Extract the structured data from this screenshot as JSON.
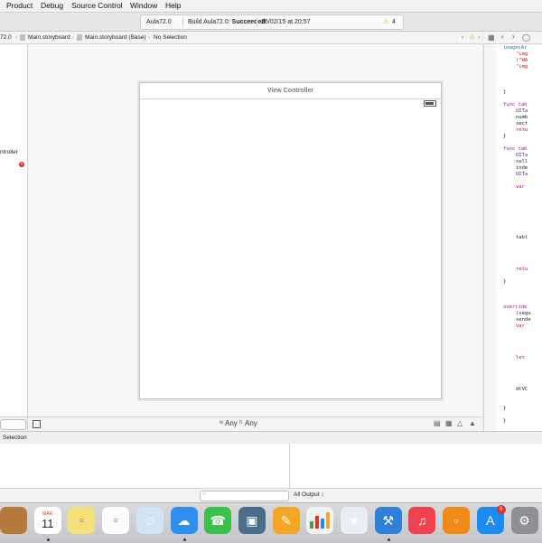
{
  "menubar": {
    "items": [
      "Product",
      "Debug",
      "Source Control",
      "Window",
      "Help"
    ]
  },
  "activity": {
    "scheme": "Aula72.0",
    "status_prefix": "Build Aula72.0: ",
    "status_result": "Succeeded",
    "timestamp": "26/02/15 at 20:57",
    "warning_count": "4",
    "warning_color": "#e6a300"
  },
  "jumpbar": {
    "crumbs": [
      "72.0",
      "Main.storyboard",
      "Main.storyboard (Base)",
      "No Selection"
    ]
  },
  "outline": {
    "item_label": "ntroller"
  },
  "scene": {
    "title": "View Controller"
  },
  "canvas_bar": {
    "size_class_width": "Any",
    "size_class_height": "Any",
    "size_prefix_w": "w",
    "size_prefix_h": "h"
  },
  "editor": {
    "lines": [
      {
        "text": "imagesAr",
        "color": "#3a6f9f",
        "indent": 0
      },
      {
        "text": "\"img",
        "color": "#c41a16",
        "indent": 2
      },
      {
        "text": "(\"WA",
        "color": "#c41a16",
        "indent": 2
      },
      {
        "text": "\"img",
        "color": "#c41a16",
        "indent": 2
      },
      {
        "text": "",
        "color": "#222",
        "indent": 0
      },
      {
        "text": "",
        "color": "#222",
        "indent": 0
      },
      {
        "text": "",
        "color": "#222",
        "indent": 0
      },
      {
        "text": "}",
        "color": "#222",
        "indent": 0
      },
      {
        "text": "",
        "color": "#222",
        "indent": 0
      },
      {
        "text": "func tab",
        "color": "#aa0d91",
        "indent": 0
      },
      {
        "text": "UITa",
        "color": "#5c2699",
        "indent": 2
      },
      {
        "text": "numb",
        "color": "#222",
        "indent": 2
      },
      {
        "text": "sect",
        "color": "#222",
        "indent": 2
      },
      {
        "text": "retu",
        "color": "#aa0d91",
        "indent": 2
      },
      {
        "text": "}",
        "color": "#222",
        "indent": 0
      },
      {
        "text": "",
        "color": "#222",
        "indent": 0
      },
      {
        "text": "func tab",
        "color": "#aa0d91",
        "indent": 0
      },
      {
        "text": "UITa",
        "color": "#5c2699",
        "indent": 2
      },
      {
        "text": "cell",
        "color": "#222",
        "indent": 2
      },
      {
        "text": "inde",
        "color": "#222",
        "indent": 2
      },
      {
        "text": "UITa",
        "color": "#5c2699",
        "indent": 2
      },
      {
        "text": "",
        "color": "#222",
        "indent": 0
      },
      {
        "text": "var",
        "color": "#aa0d91",
        "indent": 2
      },
      {
        "text": "",
        "color": "#222",
        "indent": 0
      },
      {
        "text": "",
        "color": "#222",
        "indent": 0
      },
      {
        "text": "",
        "color": "#222",
        "indent": 0
      },
      {
        "text": "",
        "color": "#222",
        "indent": 0
      },
      {
        "text": "",
        "color": "#222",
        "indent": 0
      },
      {
        "text": "",
        "color": "#222",
        "indent": 0
      },
      {
        "text": "",
        "color": "#222",
        "indent": 0
      },
      {
        "text": "tabl",
        "color": "#222",
        "indent": 2
      },
      {
        "text": "",
        "color": "#222",
        "indent": 0
      },
      {
        "text": "",
        "color": "#222",
        "indent": 0
      },
      {
        "text": "",
        "color": "#222",
        "indent": 0
      },
      {
        "text": "",
        "color": "#222",
        "indent": 0
      },
      {
        "text": "retu",
        "color": "#aa0d91",
        "indent": 2
      },
      {
        "text": "",
        "color": "#222",
        "indent": 0
      },
      {
        "text": "}",
        "color": "#222",
        "indent": 0
      },
      {
        "text": "",
        "color": "#222",
        "indent": 0
      },
      {
        "text": "",
        "color": "#222",
        "indent": 0
      },
      {
        "text": "",
        "color": "#222",
        "indent": 0
      },
      {
        "text": "override",
        "color": "#aa0d91",
        "indent": 0
      },
      {
        "text": "(segu",
        "color": "#222",
        "indent": 2
      },
      {
        "text": "sende",
        "color": "#222",
        "indent": 2
      },
      {
        "text": "var",
        "color": "#aa0d91",
        "indent": 2
      },
      {
        "text": "",
        "color": "#222",
        "indent": 0
      },
      {
        "text": "",
        "color": "#222",
        "indent": 0
      },
      {
        "text": "",
        "color": "#222",
        "indent": 0
      },
      {
        "text": "",
        "color": "#222",
        "indent": 0
      },
      {
        "text": "let",
        "color": "#aa0d91",
        "indent": 2
      },
      {
        "text": "",
        "color": "#222",
        "indent": 0
      },
      {
        "text": "",
        "color": "#222",
        "indent": 0
      },
      {
        "text": "",
        "color": "#222",
        "indent": 0
      },
      {
        "text": "",
        "color": "#222",
        "indent": 0
      },
      {
        "text": "dtVC",
        "color": "#222",
        "indent": 2
      },
      {
        "text": "",
        "color": "#222",
        "indent": 0
      },
      {
        "text": "",
        "color": "#222",
        "indent": 0
      },
      {
        "text": "}",
        "color": "#222",
        "indent": 0
      },
      {
        "text": "",
        "color": "#222",
        "indent": 0
      },
      {
        "text": "}",
        "color": "#222",
        "indent": 0
      }
    ]
  },
  "debug": {
    "header": "Selection",
    "output_selector": "All Output",
    "output_chevron": "↕"
  },
  "dock": {
    "calendar_month": "MAR",
    "calendar_day": "11",
    "appstore_badge": "6",
    "apps": [
      {
        "name": "contacts-app-icon",
        "bg": "#b57a3e",
        "glyph": ""
      },
      {
        "name": "calendar-app-icon",
        "bg": "#ffffff",
        "glyph": ""
      },
      {
        "name": "notes-app-icon",
        "bg": "#f6e07a",
        "glyph": ""
      },
      {
        "name": "reminders-app-icon",
        "bg": "#fbfbfb",
        "glyph": ""
      },
      {
        "name": "preview-app-icon",
        "bg": "#cfe4f5",
        "glyph": "☺"
      },
      {
        "name": "messages-app-icon",
        "bg": "#2e8ff0",
        "glyph": "☁"
      },
      {
        "name": "facetime-app-icon",
        "bg": "#39c24a",
        "glyph": "☎"
      },
      {
        "name": "iphoto-app-icon",
        "bg": "#4a6d8c",
        "glyph": "▣"
      },
      {
        "name": "pages-app-icon",
        "bg": "#f5a623",
        "glyph": "✎"
      },
      {
        "name": "numbers-app-icon",
        "bg": "#f2f2f2",
        "glyph": ""
      },
      {
        "name": "keynote-app-icon",
        "bg": "#e9eef5",
        "glyph": "★"
      },
      {
        "name": "xcode-app-icon",
        "bg": "#2f80d8",
        "glyph": "⚒"
      },
      {
        "name": "itunes-app-icon",
        "bg": "#f0414f",
        "glyph": "♫"
      },
      {
        "name": "ibooks-app-icon",
        "bg": "#f28a1a",
        "glyph": "▫"
      },
      {
        "name": "appstore-app-icon",
        "bg": "#1d8cf0",
        "glyph": "A"
      },
      {
        "name": "system-preferences-app-icon",
        "bg": "#8f8f94",
        "glyph": "⚙"
      }
    ]
  }
}
